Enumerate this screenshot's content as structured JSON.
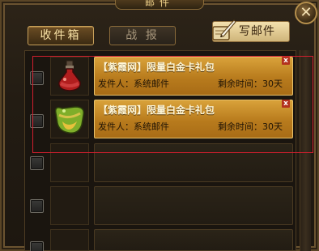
{
  "window": {
    "title": "邮件",
    "close_label": "✕"
  },
  "tabs": [
    {
      "label": "收件箱",
      "active": true
    },
    {
      "label": "战 报",
      "active": false
    }
  ],
  "compose": {
    "label": "写邮件"
  },
  "mails": [
    {
      "subject": "【紫霞网】限量白金卡礼包",
      "sender": "发件人：系统邮件",
      "time_left": "剩余时间：30天",
      "delete": "x"
    },
    {
      "subject": "【紫霞网】限量白金卡礼包",
      "sender": "发件人：系统邮件",
      "time_left": "剩余时间：30天",
      "delete": "x"
    }
  ],
  "colors": {
    "accent": "#d9a23a",
    "highlight": "#d11f2e"
  }
}
